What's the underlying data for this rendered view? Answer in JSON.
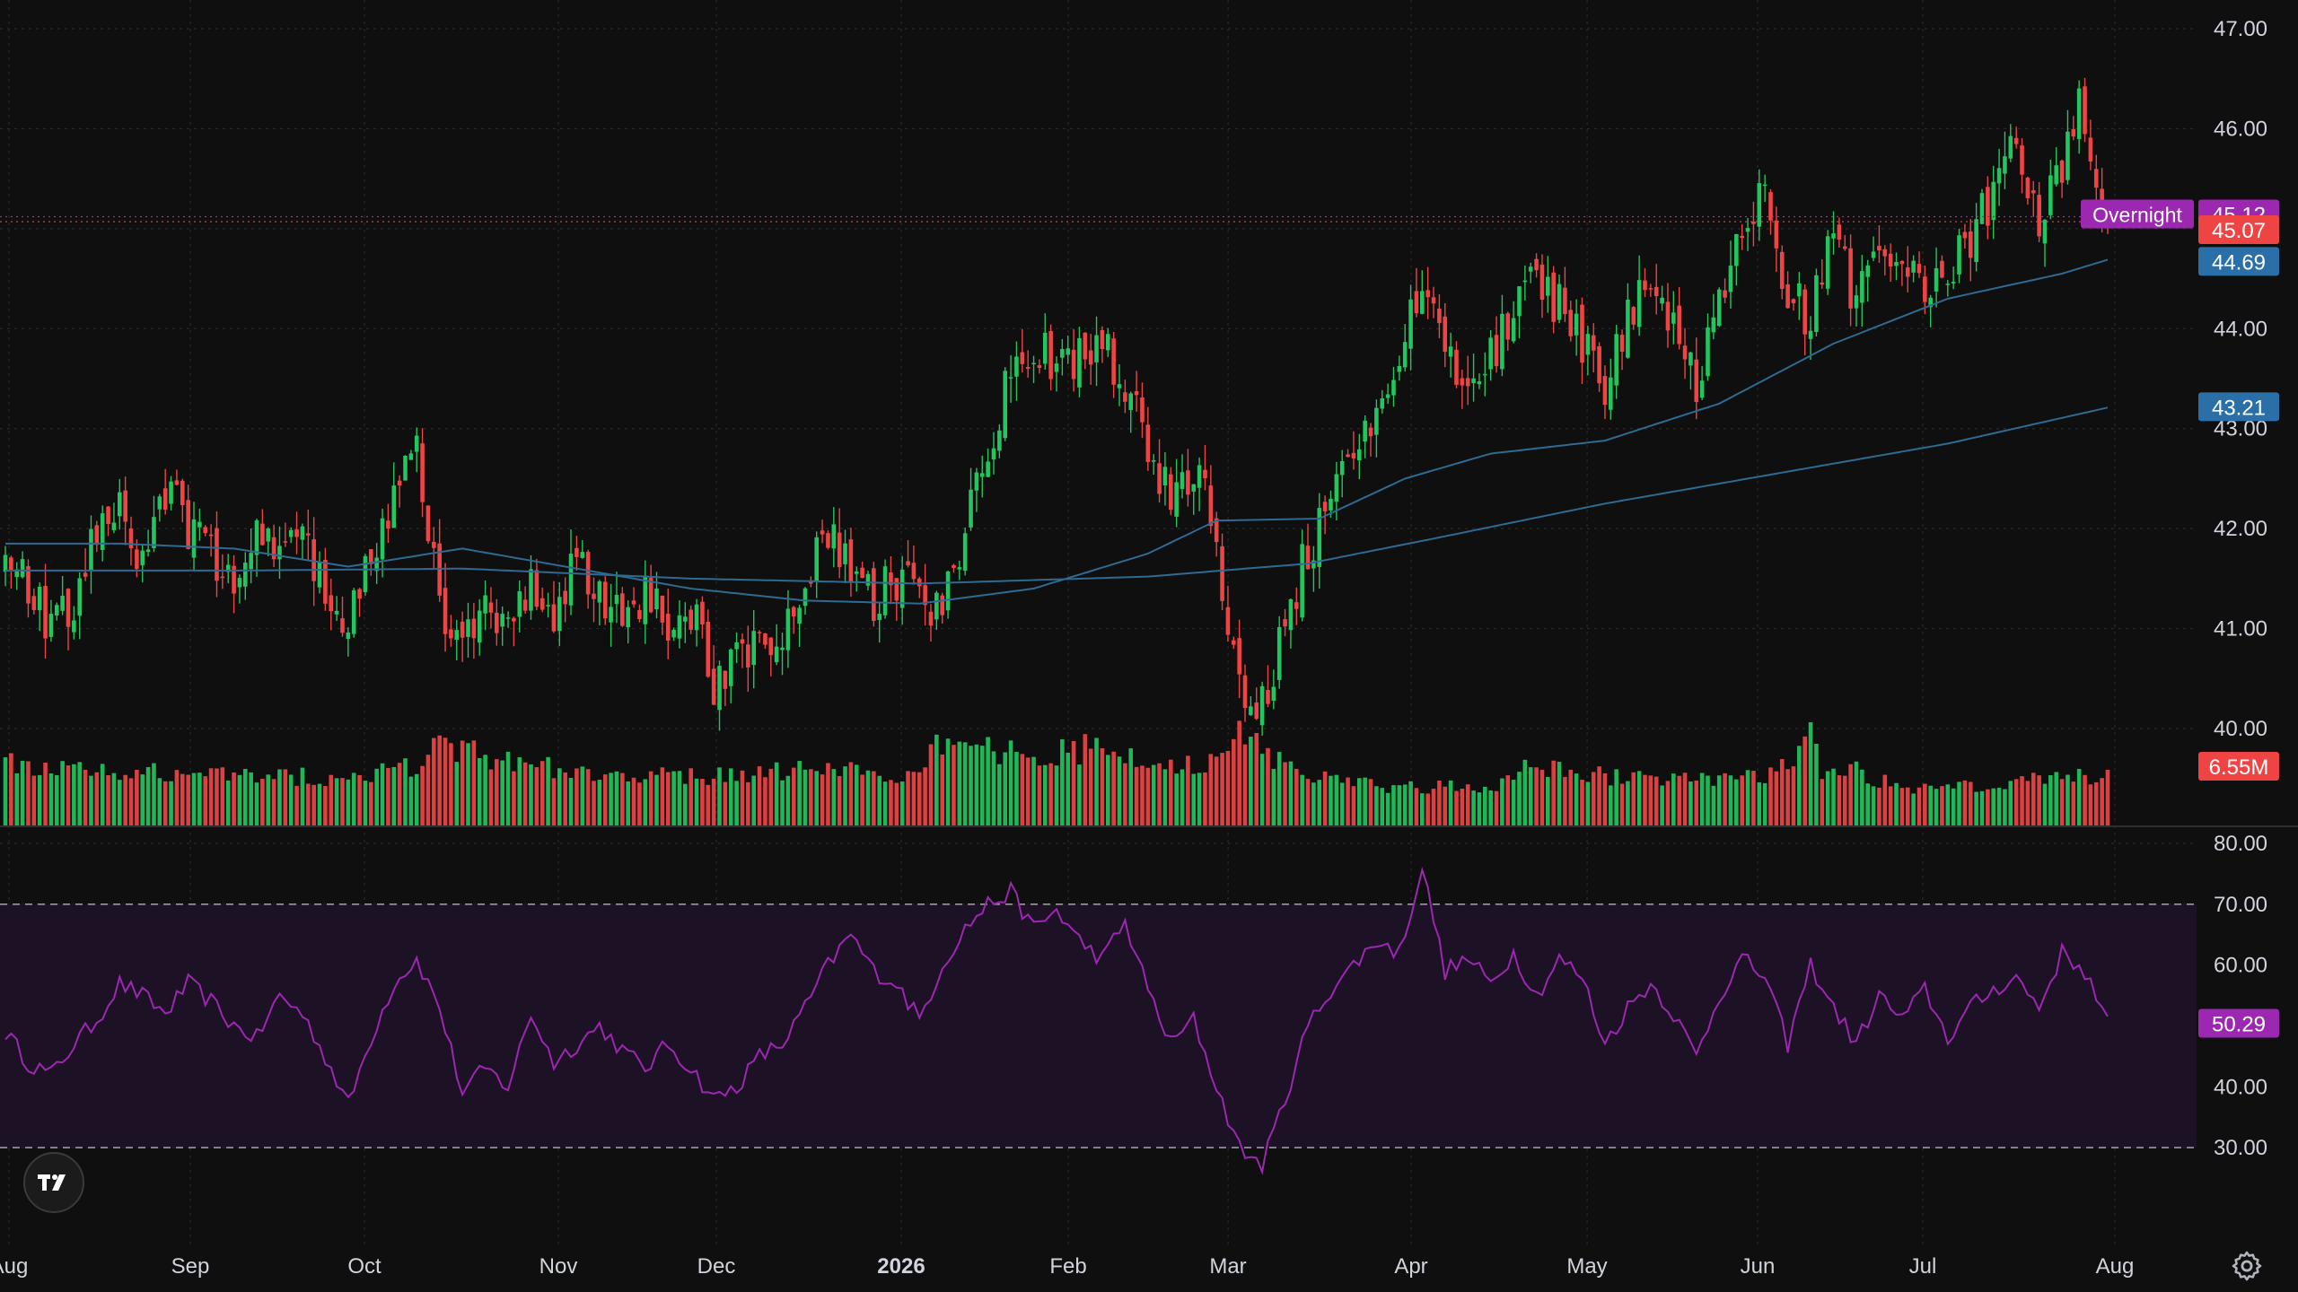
{
  "colors": {
    "background": "#0f0f0f",
    "grid": "#2a2a2a",
    "up": "#22c55e",
    "down": "#ef4444",
    "ma_short": "#2f6a92",
    "ma_long": "#2f6a92",
    "rsi_line": "#9c27b0",
    "rsi_band": "#1d1126",
    "axis_text": "#d1d4dc",
    "badge_overnight": "#9c27b0",
    "badge_price": "#ef4444",
    "badge_ma": "#2a6fa8",
    "badge_rsi": "#9c27b0"
  },
  "chart_data": [
    {
      "type": "candlestick",
      "title": "",
      "ylim": [
        40.0,
        47.0
      ],
      "y_ticks": [
        "47.00",
        "46.00",
        "45.00",
        "44.00",
        "43.00",
        "42.00",
        "41.00",
        "40.00"
      ],
      "x_tick_labels": [
        "Aug",
        "Sep",
        "Oct",
        "Nov",
        "Dec",
        "2026",
        "Feb",
        "Mar",
        "Apr",
        "May",
        "Jun",
        "Jul",
        "Aug"
      ],
      "x_tick_positions": [
        0,
        0.5,
        1,
        2.5,
        3.5,
        4.5,
        5.5,
        6.5,
        7.5,
        8.5,
        9.5,
        10.5,
        11.5
      ],
      "close_anchors": [
        [
          0,
          41.6
        ],
        [
          4,
          41.5
        ],
        [
          8,
          41.0
        ],
        [
          12,
          41.3
        ],
        [
          16,
          41.9
        ],
        [
          20,
          42.2
        ],
        [
          24,
          41.7
        ],
        [
          28,
          42.4
        ],
        [
          32,
          42.0
        ],
        [
          36,
          41.8
        ],
        [
          40,
          41.5
        ],
        [
          44,
          41.9
        ],
        [
          48,
          41.7
        ],
        [
          52,
          42.0
        ],
        [
          56,
          41.4
        ],
        [
          60,
          41.0
        ],
        [
          64,
          41.8
        ],
        [
          68,
          42.3
        ],
        [
          72,
          42.8
        ],
        [
          76,
          41.2
        ],
        [
          80,
          40.9
        ],
        [
          84,
          41.2
        ],
        [
          88,
          41.0
        ],
        [
          92,
          41.5
        ],
        [
          96,
          41.2
        ],
        [
          100,
          41.7
        ],
        [
          104,
          41.3
        ],
        [
          108,
          41.1
        ],
        [
          112,
          41.3
        ],
        [
          116,
          41.0
        ],
        [
          120,
          41.2
        ],
        [
          124,
          40.4
        ],
        [
          128,
          40.7
        ],
        [
          132,
          41.0
        ],
        [
          136,
          40.8
        ],
        [
          140,
          41.4
        ],
        [
          144,
          42.0
        ],
        [
          148,
          41.6
        ],
        [
          152,
          41.3
        ],
        [
          156,
          41.5
        ],
        [
          160,
          41.3
        ],
        [
          164,
          41.2
        ],
        [
          168,
          41.9
        ],
        [
          172,
          42.9
        ],
        [
          176,
          43.5
        ],
        [
          180,
          43.9
        ],
        [
          184,
          43.6
        ],
        [
          188,
          43.7
        ],
        [
          192,
          43.8
        ],
        [
          196,
          43.4
        ],
        [
          200,
          42.8
        ],
        [
          204,
          42.3
        ],
        [
          208,
          42.6
        ],
        [
          212,
          42.1
        ],
        [
          214,
          40.8
        ],
        [
          216,
          40.4
        ],
        [
          220,
          40.2
        ],
        [
          224,
          41.0
        ],
        [
          228,
          41.8
        ],
        [
          232,
          42.3
        ],
        [
          236,
          42.6
        ],
        [
          240,
          43.2
        ],
        [
          244,
          43.8
        ],
        [
          248,
          44.5
        ],
        [
          252,
          43.8
        ],
        [
          256,
          43.5
        ],
        [
          260,
          43.7
        ],
        [
          264,
          44.1
        ],
        [
          268,
          44.5
        ],
        [
          272,
          44.2
        ],
        [
          276,
          43.9
        ],
        [
          280,
          43.4
        ],
        [
          284,
          44.1
        ],
        [
          288,
          44.6
        ],
        [
          292,
          44.0
        ],
        [
          296,
          43.4
        ],
        [
          300,
          44.3
        ],
        [
          304,
          45.0
        ],
        [
          308,
          45.3
        ],
        [
          312,
          44.4
        ],
        [
          316,
          44.1
        ],
        [
          320,
          44.9
        ],
        [
          324,
          44.3
        ],
        [
          328,
          44.6
        ],
        [
          332,
          44.7
        ],
        [
          336,
          44.2
        ],
        [
          340,
          44.6
        ],
        [
          344,
          44.9
        ],
        [
          348,
          45.4
        ],
        [
          352,
          45.8
        ],
        [
          356,
          45.1
        ],
        [
          360,
          45.6
        ],
        [
          363,
          46.2
        ],
        [
          366,
          45.5
        ],
        [
          368,
          45.07
        ]
      ],
      "ma_short": {
        "label": "44.69",
        "values": [
          [
            0,
            41.85
          ],
          [
            20,
            41.85
          ],
          [
            40,
            41.8
          ],
          [
            60,
            41.62
          ],
          [
            80,
            41.8
          ],
          [
            100,
            41.6
          ],
          [
            120,
            41.4
          ],
          [
            140,
            41.28
          ],
          [
            160,
            41.25
          ],
          [
            180,
            41.4
          ],
          [
            200,
            41.75
          ],
          [
            212,
            42.08
          ],
          [
            230,
            42.1
          ],
          [
            245,
            42.5
          ],
          [
            260,
            42.75
          ],
          [
            280,
            42.88
          ],
          [
            300,
            43.25
          ],
          [
            320,
            43.85
          ],
          [
            340,
            44.3
          ],
          [
            360,
            44.55
          ],
          [
            368,
            44.69
          ]
        ]
      },
      "ma_long": {
        "label": "43.21",
        "values": [
          [
            0,
            41.58
          ],
          [
            40,
            41.58
          ],
          [
            80,
            41.6
          ],
          [
            120,
            41.5
          ],
          [
            160,
            41.45
          ],
          [
            200,
            41.52
          ],
          [
            228,
            41.65
          ],
          [
            250,
            41.9
          ],
          [
            280,
            42.25
          ],
          [
            300,
            42.45
          ],
          [
            320,
            42.65
          ],
          [
            340,
            42.85
          ],
          [
            368,
            43.21
          ]
        ]
      },
      "badges": {
        "overnight_label": "Overnight",
        "overnight_value": "45.12",
        "last_price": "45.07"
      }
    },
    {
      "type": "bar",
      "series_name": "",
      "last_value_label": "6.55M",
      "anchors": [
        [
          0,
          8.4
        ],
        [
          20,
          7.2
        ],
        [
          40,
          6.8
        ],
        [
          60,
          6.6
        ],
        [
          72,
          8.0
        ],
        [
          76,
          12.3
        ],
        [
          80,
          10.0
        ],
        [
          100,
          7.2
        ],
        [
          120,
          6.7
        ],
        [
          140,
          7.5
        ],
        [
          160,
          7.0
        ],
        [
          164,
          11.8
        ],
        [
          168,
          10.5
        ],
        [
          180,
          9.3
        ],
        [
          190,
          10.5
        ],
        [
          200,
          8.0
        ],
        [
          212,
          8.5
        ],
        [
          214,
          12.5
        ],
        [
          218,
          11.5
        ],
        [
          222,
          9.5
        ],
        [
          226,
          7.0
        ],
        [
          240,
          5.5
        ],
        [
          260,
          5.2
        ],
        [
          268,
          8.2
        ],
        [
          280,
          6.7
        ],
        [
          300,
          6.4
        ],
        [
          310,
          7.0
        ],
        [
          316,
          13.0
        ],
        [
          318,
          7.5
        ],
        [
          324,
          7.5
        ],
        [
          330,
          5.5
        ],
        [
          340,
          4.8
        ],
        [
          350,
          6.0
        ],
        [
          360,
          6.6
        ],
        [
          368,
          6.55
        ]
      ]
    },
    {
      "type": "line",
      "series_name": "",
      "ylim": [
        25,
        80
      ],
      "y_ticks": [
        "80.00",
        "70.00",
        "60.00",
        "50.00",
        "40.00",
        "30.00"
      ],
      "band": [
        30,
        70
      ],
      "last_value_label": "50.29",
      "values": [
        [
          0,
          49
        ],
        [
          4,
          44
        ],
        [
          8,
          42
        ],
        [
          12,
          47
        ],
        [
          16,
          51
        ],
        [
          20,
          57
        ],
        [
          24,
          55
        ],
        [
          28,
          52
        ],
        [
          32,
          57
        ],
        [
          36,
          54
        ],
        [
          40,
          50
        ],
        [
          44,
          48
        ],
        [
          48,
          55
        ],
        [
          52,
          52
        ],
        [
          56,
          45
        ],
        [
          60,
          37
        ],
        [
          64,
          48
        ],
        [
          68,
          57
        ],
        [
          72,
          61
        ],
        [
          76,
          53
        ],
        [
          80,
          39
        ],
        [
          84,
          43
        ],
        [
          88,
          40
        ],
        [
          92,
          52
        ],
        [
          96,
          44
        ],
        [
          100,
          47
        ],
        [
          104,
          50
        ],
        [
          108,
          46
        ],
        [
          112,
          43
        ],
        [
          116,
          47
        ],
        [
          120,
          43
        ],
        [
          124,
          38
        ],
        [
          128,
          40
        ],
        [
          132,
          45
        ],
        [
          136,
          47
        ],
        [
          140,
          53
        ],
        [
          144,
          60
        ],
        [
          148,
          65
        ],
        [
          152,
          59
        ],
        [
          156,
          57
        ],
        [
          160,
          51
        ],
        [
          164,
          60
        ],
        [
          168,
          66
        ],
        [
          172,
          70
        ],
        [
          176,
          72
        ],
        [
          180,
          66
        ],
        [
          184,
          69
        ],
        [
          188,
          64
        ],
        [
          192,
          61
        ],
        [
          196,
          67
        ],
        [
          200,
          56
        ],
        [
          204,
          47
        ],
        [
          208,
          51
        ],
        [
          212,
          40
        ],
        [
          216,
          30
        ],
        [
          220,
          27
        ],
        [
          224,
          38
        ],
        [
          228,
          50
        ],
        [
          232,
          56
        ],
        [
          236,
          60
        ],
        [
          240,
          64
        ],
        [
          244,
          62
        ],
        [
          248,
          76
        ],
        [
          252,
          59
        ],
        [
          256,
          61
        ],
        [
          260,
          57
        ],
        [
          264,
          62
        ],
        [
          268,
          55
        ],
        [
          272,
          61
        ],
        [
          276,
          58
        ],
        [
          280,
          47
        ],
        [
          284,
          53
        ],
        [
          288,
          57
        ],
        [
          292,
          52
        ],
        [
          296,
          45
        ],
        [
          300,
          55
        ],
        [
          304,
          61
        ],
        [
          308,
          58
        ],
        [
          312,
          47
        ],
        [
          316,
          60
        ],
        [
          320,
          53
        ],
        [
          324,
          47
        ],
        [
          328,
          55
        ],
        [
          332,
          51
        ],
        [
          336,
          56
        ],
        [
          340,
          48
        ],
        [
          344,
          53
        ],
        [
          348,
          56
        ],
        [
          352,
          58
        ],
        [
          356,
          53
        ],
        [
          360,
          62
        ],
        [
          364,
          59
        ],
        [
          368,
          50.29
        ]
      ]
    }
  ]
}
